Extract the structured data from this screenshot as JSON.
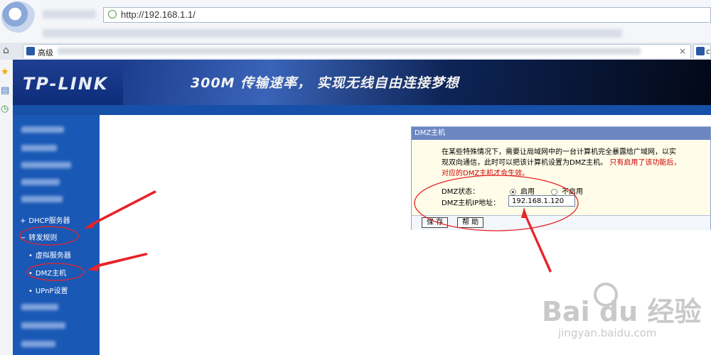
{
  "browser": {
    "address": "http://192.168.1.1/",
    "tabs": [
      {
        "label": "高级"
      },
      {
        "label": "c"
      }
    ]
  },
  "router": {
    "brand": "TP-LINK",
    "slogan": "300M 传输速率，   实现无线自由连接梦想"
  },
  "sidebar": {
    "items": [
      {
        "label": "DHCP服务器",
        "bullet": "+"
      },
      {
        "label": "转发规则",
        "bullet": "−"
      },
      {
        "label": "虚拟服务器",
        "bullet": "•"
      },
      {
        "label": "DMZ主机",
        "bullet": "•"
      },
      {
        "label": "UPnP设置",
        "bullet": "•"
      }
    ]
  },
  "dmz": {
    "title": "DMZ主机",
    "desc_line1": "在某些特殊情况下，需要让局域网中的一台计算机完全暴露给广域网，以实",
    "desc_line2": "现双向通信，此时可以把该计算机设置为DMZ主机。",
    "desc_warn1": "只有启用了该功能后，",
    "desc_warn2": "对应的DMZ主机才会生效。",
    "status_label": "DMZ状态：",
    "opt_on": "启用",
    "opt_off": "不启用",
    "ip_label": "DMZ主机IP地址：",
    "ip_value": "192.168.1.120",
    "save_label": "保 存",
    "help_label": "帮 助"
  },
  "watermark": {
    "brand": "Bai  du 经验",
    "url": "jingyan.baidu.com"
  },
  "colors": {
    "accent_red": "#e8232a",
    "panel_title": "#6c86c2",
    "menu_blue": "#1a58b5"
  }
}
